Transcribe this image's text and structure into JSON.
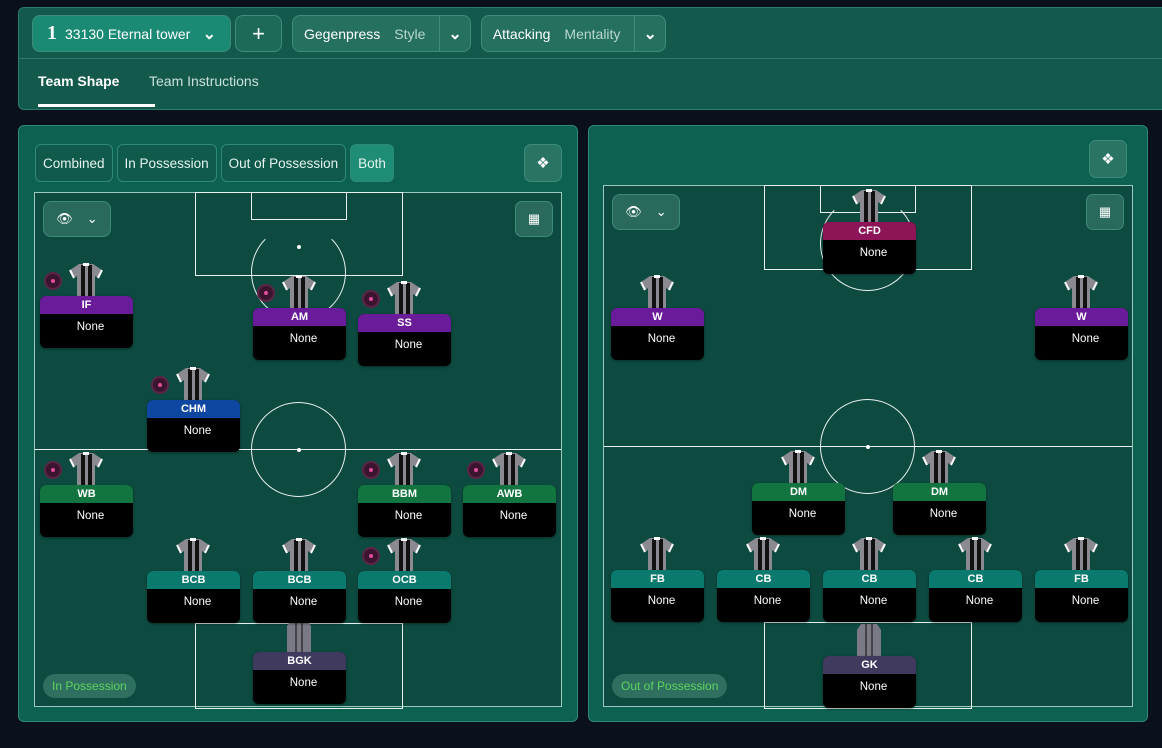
{
  "header": {
    "tactic_number": "1",
    "tactic_name": "33130 Eternal tower",
    "add_label": "+",
    "style": {
      "value": "Gegenpress",
      "label": "Style"
    },
    "mentality": {
      "value": "Attacking",
      "label": "Mentality"
    },
    "tabs": [
      {
        "label": "Team Shape",
        "active": true
      },
      {
        "label": "Team Instructions",
        "active": false
      }
    ]
  },
  "left_panel": {
    "view_tabs": [
      {
        "label": "Combined"
      },
      {
        "label": "In Possession"
      },
      {
        "label": "Out of Possession"
      },
      {
        "label": "Both",
        "active": true
      }
    ],
    "phase_label": "In Possession",
    "players": [
      {
        "role": "IF",
        "player": "None",
        "color": "#6a1b9a",
        "badge": true
      },
      {
        "role": "AM",
        "player": "None",
        "color": "#6a1b9a",
        "badge": true
      },
      {
        "role": "SS",
        "player": "None",
        "color": "#6a1b9a",
        "badge": true
      },
      {
        "role": "CHM",
        "player": "None",
        "color": "#0d47a1",
        "badge": true
      },
      {
        "role": "WB",
        "player": "None",
        "color": "#12753f",
        "badge": true
      },
      {
        "role": "BBM",
        "player": "None",
        "color": "#12753f",
        "badge": true
      },
      {
        "role": "AWB",
        "player": "None",
        "color": "#12753f",
        "badge": true
      },
      {
        "role": "BCB",
        "player": "None",
        "color": "#0b7a6e",
        "badge": false
      },
      {
        "role": "BCB",
        "player": "None",
        "color": "#0b7a6e",
        "badge": false
      },
      {
        "role": "OCB",
        "player": "None",
        "color": "#0b7a6e",
        "badge": true
      },
      {
        "role": "BGK",
        "player": "None",
        "color": "#3f3a5e",
        "badge": false,
        "gk": true
      }
    ]
  },
  "right_panel": {
    "phase_label": "Out of Possession",
    "players": [
      {
        "role": "CFD",
        "player": "None",
        "color": "#8c1457"
      },
      {
        "role": "W",
        "player": "None",
        "color": "#6a1b9a"
      },
      {
        "role": "W",
        "player": "None",
        "color": "#6a1b9a"
      },
      {
        "role": "DM",
        "player": "None",
        "color": "#12753f"
      },
      {
        "role": "DM",
        "player": "None",
        "color": "#12753f"
      },
      {
        "role": "FB",
        "player": "None",
        "color": "#0b7a6e"
      },
      {
        "role": "CB",
        "player": "None",
        "color": "#0b7a6e"
      },
      {
        "role": "CB",
        "player": "None",
        "color": "#0b7a6e"
      },
      {
        "role": "CB",
        "player": "None",
        "color": "#0b7a6e"
      },
      {
        "role": "FB",
        "player": "None",
        "color": "#0b7a6e"
      },
      {
        "role": "GK",
        "player": "None",
        "color": "#3f3a5e",
        "gk": true
      }
    ]
  }
}
